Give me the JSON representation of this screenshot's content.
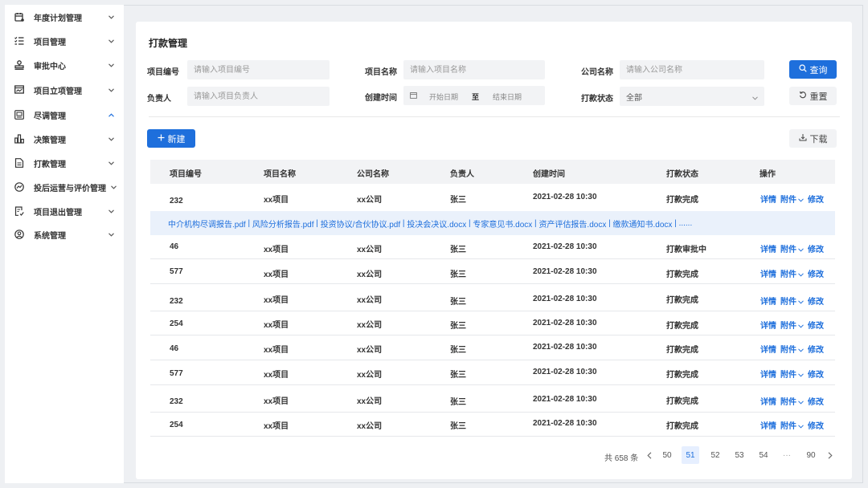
{
  "sidebar": {
    "items": [
      {
        "label": "年度计划管理",
        "icon": "calendar-icon",
        "expanded": false
      },
      {
        "label": "项目管理",
        "icon": "list-icon",
        "expanded": false
      },
      {
        "label": "审批中心",
        "icon": "stamp-icon",
        "expanded": false
      },
      {
        "label": "项目立项管理",
        "icon": "chart-board-icon",
        "expanded": false
      },
      {
        "label": "尽调管理",
        "icon": "image-frame-icon",
        "expanded": true
      },
      {
        "label": "决策管理",
        "icon": "bar-chart-icon",
        "expanded": false
      },
      {
        "label": "打款管理",
        "icon": "document-icon",
        "expanded": false
      },
      {
        "label": "投后运营与评价管理",
        "icon": "gauge-icon",
        "expanded": false
      },
      {
        "label": "项目退出管理",
        "icon": "exit-form-icon",
        "expanded": false
      },
      {
        "label": "系统管理",
        "icon": "user-circle-icon",
        "expanded": false
      }
    ]
  },
  "page": {
    "title": "打款管理"
  },
  "filters": {
    "project_code": {
      "label": "项目编号",
      "placeholder": "请输入项目编号"
    },
    "project_name": {
      "label": "项目名称",
      "placeholder": "请输入项目名称"
    },
    "company_name": {
      "label": "公司名称",
      "placeholder": "请输入公司名称"
    },
    "owner": {
      "label": "负责人",
      "placeholder": "请输入项目负责人"
    },
    "created_time": {
      "label": "创建时间",
      "start_placeholder": "开始日期",
      "separator": "至",
      "end_placeholder": "结束日期"
    },
    "payment_status": {
      "label": "打款状态",
      "value": "全部"
    },
    "search_label": "查询",
    "reset_label": "重置"
  },
  "toolbar": {
    "new_label": "新建",
    "download_label": "下载"
  },
  "table": {
    "columns": [
      "项目编号",
      "项目名称",
      "公司名称",
      "负责人",
      "创建时间",
      "打款状态",
      "操作"
    ],
    "actions": {
      "detail": "详情",
      "attachment": "附件",
      "edit": "修改"
    },
    "rows": [
      {
        "code": "232",
        "name": "xx项目",
        "company": "xx公司",
        "owner": "张三",
        "time": "2021-02-28 10:30",
        "status": "打款完成"
      },
      {
        "code": "46",
        "name": "xx项目",
        "company": "xx公司",
        "owner": "张三",
        "time": "2021-02-28 10:30",
        "status": "打款审批中"
      },
      {
        "code": "577",
        "name": "xx项目",
        "company": "xx公司",
        "owner": "张三",
        "time": "2021-02-28 10:30",
        "status": "打款完成"
      },
      {
        "code": "232",
        "name": "xx项目",
        "company": "xx公司",
        "owner": "张三",
        "time": "2021-02-28 10:30",
        "status": "打款完成"
      },
      {
        "code": "254",
        "name": "xx项目",
        "company": "xx公司",
        "owner": "张三",
        "time": "2021-02-28 10:30",
        "status": "打款完成"
      },
      {
        "code": "46",
        "name": "xx项目",
        "company": "xx公司",
        "owner": "张三",
        "time": "2021-02-28 10:30",
        "status": "打款完成"
      },
      {
        "code": "577",
        "name": "xx项目",
        "company": "xx公司",
        "owner": "张三",
        "time": "2021-02-28 10:30",
        "status": "打款完成"
      },
      {
        "code": "232",
        "name": "xx项目",
        "company": "xx公司",
        "owner": "张三",
        "time": "2021-02-28 10:30",
        "status": "打款完成"
      },
      {
        "code": "254",
        "name": "xx项目",
        "company": "xx公司",
        "owner": "张三",
        "time": "2021-02-28 10:30",
        "status": "打款完成"
      }
    ],
    "attachments": [
      "中介机构尽调报告.pdf",
      "风险分析报告.pdf",
      "投资协议/合伙协议.pdf",
      "投决会决议.docx",
      "专家意见书.docx",
      "资产评估报告.docx",
      "缴款通知书.docx",
      "......"
    ]
  },
  "pagination": {
    "total_text": "共 658 条",
    "pages": [
      "50",
      "51",
      "52",
      "53",
      "54",
      "···",
      "90"
    ],
    "current": "51"
  },
  "colors": {
    "primary": "#1e6fdc",
    "attachment_bg": "#eaf1fb",
    "header_bg": "#f2f3f5"
  }
}
